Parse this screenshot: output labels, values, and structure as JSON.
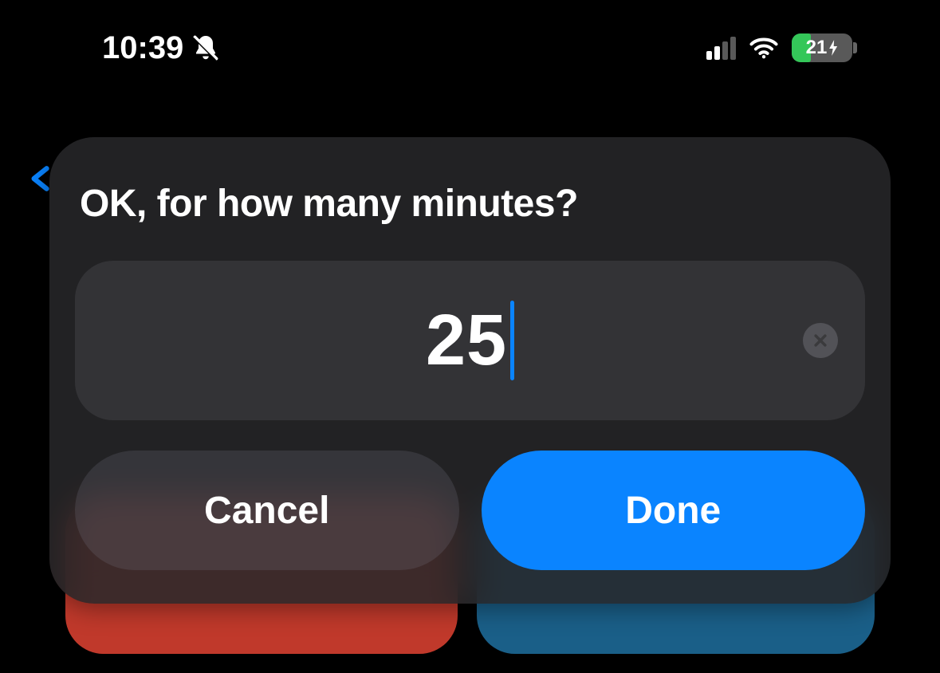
{
  "status": {
    "time": "10:39",
    "silent": true,
    "cellular_bars_active": 2,
    "cellular_bars_total": 4,
    "wifi": true,
    "battery_percent": 21,
    "battery_charging": true,
    "battery_color": "#34c759",
    "battery_label": "21"
  },
  "dialog": {
    "title": "OK, for how many minutes?",
    "input_value": "25",
    "clear_icon": "close-icon",
    "buttons": {
      "cancel": "Cancel",
      "done": "Done"
    }
  },
  "colors": {
    "accent": "#0a84ff",
    "bg_red": "#c0392b",
    "bg_blue": "#1a5f88"
  }
}
